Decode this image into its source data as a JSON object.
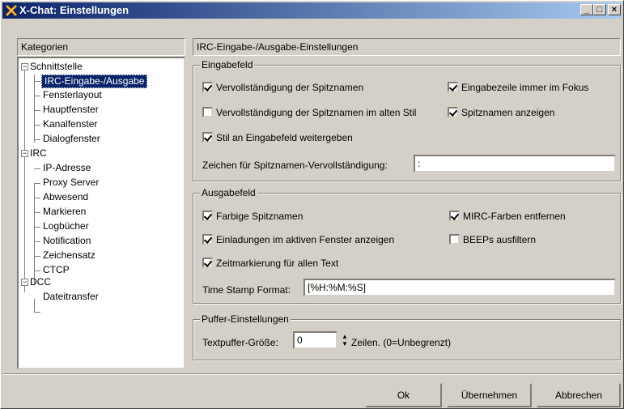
{
  "window": {
    "title": "X-Chat: Einstellungen",
    "minimize": "_",
    "maximize": "□",
    "close": "×"
  },
  "sidebar": {
    "header": "Kategorien",
    "groups": [
      {
        "label": "Schnittstelle",
        "expander": "−",
        "items": [
          "IRC-Eingabe-/Ausgabe",
          "Fensterlayout",
          "Hauptfenster",
          "Kanalfenster",
          "Dialogfenster"
        ]
      },
      {
        "label": "IRC",
        "expander": "−",
        "items": [
          "IP-Adresse",
          "Proxy Server",
          "Abwesend",
          "Markieren",
          "Logbücher",
          "Notification",
          "Zeichensatz",
          "CTCP"
        ]
      },
      {
        "label": "DCC",
        "expander": "−",
        "items": [
          "Dateitransfer"
        ]
      }
    ],
    "selected": "IRC-Eingabe-/Ausgabe"
  },
  "main": {
    "header": "IRC-Eingabe-/Ausgabe-Einstellungen",
    "eingabe": {
      "title": "Eingabefeld",
      "options": [
        {
          "label": "Vervollständigung der Spitznamen",
          "checked": true
        },
        {
          "label": "Eingabezeile immer im Fokus",
          "checked": true
        },
        {
          "label": "Vervollständigung der Spitznamen im alten Stil",
          "checked": false
        },
        {
          "label": "Spitznamen anzeigen",
          "checked": true
        },
        {
          "label": "Stil an Eingabefeld weitergeben",
          "checked": true
        }
      ],
      "completion_label": "Zeichen für Spitznamen-Vervollständigung:",
      "completion_value": ":"
    },
    "ausgabe": {
      "title": "Ausgabefeld",
      "options": [
        {
          "label": "Farbige Spitznamen",
          "checked": true
        },
        {
          "label": "MIRC-Farben entfernen",
          "checked": true
        },
        {
          "label": "Einladungen im aktiven Fenster anzeigen",
          "checked": true
        },
        {
          "label": "BEEPs ausfiltern",
          "checked": false
        },
        {
          "label": "Zeitmarkierung für allen Text",
          "checked": true
        }
      ],
      "timestamp_label": "Time Stamp Format:",
      "timestamp_value": "[%H:%M:%S]"
    },
    "puffer": {
      "title": "Puffer-Einstellungen",
      "size_label": "Textpuffer-Größe:",
      "size_value": "0",
      "size_suffix": "Zeilen. (0=Unbegrenzt)"
    }
  },
  "buttons": {
    "ok": "Ok",
    "apply": "Übernehmen",
    "cancel": "Abbrechen"
  }
}
